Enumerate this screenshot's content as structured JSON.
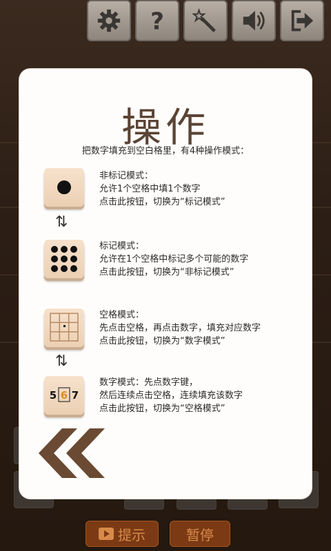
{
  "toolbar": {
    "buttons": [
      {
        "icon": "gear-icon"
      },
      {
        "icon": "question-icon"
      },
      {
        "icon": "magic-wand-icon"
      },
      {
        "icon": "speaker-icon"
      },
      {
        "icon": "exit-icon"
      }
    ]
  },
  "dialog": {
    "title": "操作",
    "subtitle": "把数字填充到空白格里，有4种操作模式：",
    "modes": [
      {
        "name": "非标记模式：",
        "lines": [
          "允许1个空格中填1个数字",
          "点击此按钮，切换为“标记模式”"
        ]
      },
      {
        "name": "标记模式：",
        "lines": [
          "允许在1个空格中标记多个可能的数字",
          "点击此按钮，切换为“非标记模式”"
        ]
      },
      {
        "name": "空格模式：",
        "lines": [
          "先点击空格，再点击数字，填充对应数字",
          "点击此按钮，切换为“数字模式”"
        ]
      },
      {
        "name": "数字模式：先点数字键，",
        "lines": [
          "然后连续点击空格，连续填充该数字",
          "点击此按钮，切换为“空格模式”"
        ]
      }
    ],
    "swap_symbol": "⇅",
    "digit_icon": {
      "left": "5",
      "middle": "6",
      "right": "7"
    }
  },
  "bottom_bar": {
    "hint_label": "提示",
    "pause_label": "暂停"
  },
  "colors": {
    "accent_orange": "#d88a4a",
    "dialog_bg": "#fffdfb",
    "title_brown": "#5b4436",
    "chevron_brown": "#6b4a33"
  }
}
